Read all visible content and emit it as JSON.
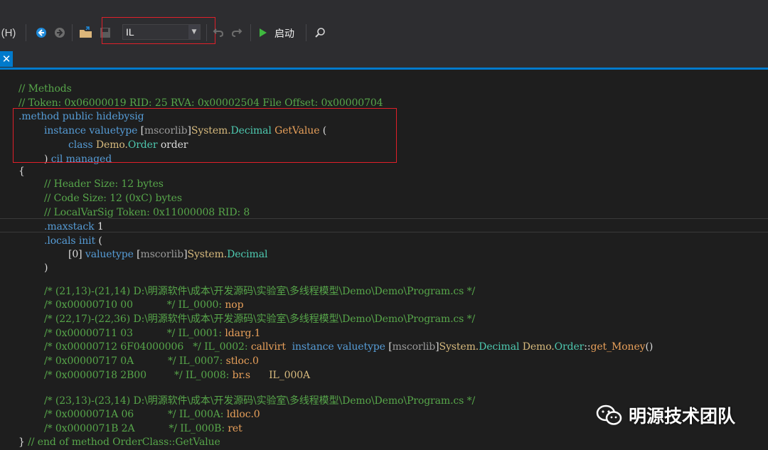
{
  "toolbar": {
    "menu_help": "(H)",
    "combo_value": "IL",
    "start_label": "启动",
    "icons": [
      "back-icon",
      "forward-icon",
      "open-folder-icon",
      "save-icon",
      "undo-icon",
      "redo-icon",
      "play-icon",
      "search-icon"
    ]
  },
  "tab": {
    "close_glyph": "✕"
  },
  "code": {
    "l1": "// Methods",
    "l2": "// Token: 0x06000019 RID: 25 RVA: 0x00002504 File Offset: 0x00000704",
    "l3_a": ".method public hidebysig",
    "l4_a": "instance valuetype",
    "l4_b": "[",
    "l4_c": "mscorlib",
    "l4_d": "]",
    "l4_e": "System.",
    "l4_f": "Decimal",
    "l4_g": "GetValue",
    "l4_h": "(",
    "l5_a": "class",
    "l5_b": "Demo.",
    "l5_c": "Order",
    "l5_d": "order",
    "l6_a": ")",
    "l6_b": "cil managed",
    "l7": "{",
    "l8": "// Header Size: 12 bytes",
    "l9": "// Code Size: 12 (0xC) bytes",
    "l10": "// LocalVarSig Token: 0x11000008 RID: 8",
    "l11_a": ".maxstack",
    "l11_b": "1",
    "l12_a": ".locals init",
    "l12_b": "(",
    "l13_a": "[0]",
    "l13_b": "valuetype",
    "l13_c": "[",
    "l13_d": "mscorlib",
    "l13_e": "]",
    "l13_f": "System.",
    "l13_g": "Decimal",
    "l14": ")",
    "l15": "/* (21,13)-(21,14) D:\\明源软件\\成本\\开发源码\\实验室\\多线程模型\\Demo\\Demo\\Program.cs */",
    "l16_a": "/* 0x00000710 00           */ IL_0000:",
    "l16_b": "nop",
    "l17": "/* (22,17)-(22,36) D:\\明源软件\\成本\\开发源码\\实验室\\多线程模型\\Demo\\Demo\\Program.cs */",
    "l18_a": "/* 0x00000711 03           */ IL_0001:",
    "l18_b": "ldarg.1",
    "l19_a": "/* 0x00000712 6F04000006   */ IL_0002:",
    "l19_b": "callvirt",
    "l19_c": "instance valuetype",
    "l19_d": "[",
    "l19_e": "mscorlib",
    "l19_f": "]",
    "l19_g": "System.",
    "l19_h": "Decimal",
    "l19_i": "Demo.",
    "l19_j": "Order",
    "l19_k": "::",
    "l19_l": "get_Money",
    "l19_m": "()",
    "l20_a": "/* 0x00000717 0A           */ IL_0007:",
    "l20_b": "stloc.0",
    "l21_a": "/* 0x00000718 2B00         */ IL_0008:",
    "l21_b": "br.s",
    "l21_c": "IL_000A",
    "l22": "/* (23,13)-(23,14) D:\\明源软件\\成本\\开发源码\\实验室\\多线程模型\\Demo\\Demo\\Program.cs */",
    "l23_a": "/* 0x0000071A 06           */ IL_000A:",
    "l23_b": "ldloc.0",
    "l24_a": "/* 0x0000071B 2A           */ IL_000B:",
    "l24_b": "ret",
    "l25_a": "}",
    "l25_b": "// end of method OrderClass::GetValue"
  },
  "watermark": {
    "text": "明源技术团队",
    "icon": "wechat-icon"
  },
  "colors": {
    "accent": "#007acc",
    "highlight_box": "#e0202a",
    "comment": "#57a64a",
    "keyword": "#569cd6",
    "type": "#4ec9b0",
    "member": "#d7ba7d"
  }
}
